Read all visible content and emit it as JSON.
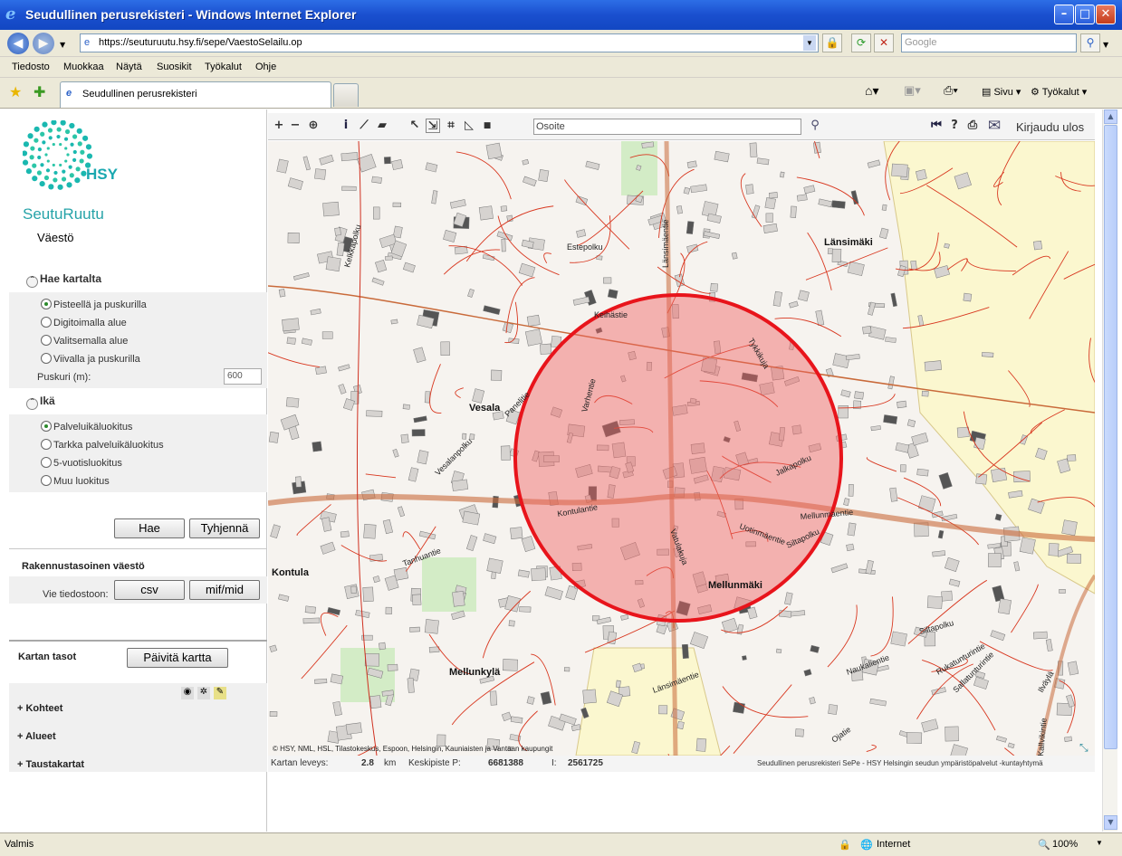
{
  "window": {
    "title": "Seudullinen perusrekisteri - Windows Internet Explorer",
    "url": "https://seuturuutu.hsy.fi/sepe/VaestoSelailu.op",
    "search_placeholder": "Google"
  },
  "menu": [
    "Tiedosto",
    "Muokkaa",
    "Näytä",
    "Suosikit",
    "Työkalut",
    "Ohje"
  ],
  "tab": {
    "label": "Seudullinen perusrekisteri"
  },
  "toolbar_right": {
    "sivu": "Sivu",
    "tyokalut": "Työkalut"
  },
  "left": {
    "logo_text": "HSY",
    "app_title": "SeutuRuutu",
    "app_subtitle": "Väestö",
    "hae_kartalta": {
      "title": "Hae kartalta",
      "options": [
        "Pisteellä ja puskurilla",
        "Digitoimalla alue",
        "Valitsemalla alue",
        "Viivalla ja puskurilla"
      ],
      "selected": "Pisteellä ja puskurilla",
      "buffer_label": "Puskuri (m):",
      "buffer_value": "600"
    },
    "ika": {
      "title": "Ikä",
      "options": [
        "Palveluikäluokitus",
        "Tarkka palveluikäluokitus",
        "5-vuotisluokitus",
        "Muu luokitus"
      ],
      "selected": "Palveluikäluokitus"
    },
    "buttons": {
      "hae": "Hae",
      "tyhjenna": "Tyhjennä"
    },
    "rakennus": {
      "title": "Rakennustasoinen väestö",
      "export_label": "Vie tiedostoon:",
      "csv": "csv",
      "mif": "mif/mid"
    },
    "layers": {
      "title": "Kartan tasot",
      "refresh": "Päivitä kartta",
      "groups": [
        "Kohteet",
        "Alueet",
        "Taustakartat"
      ]
    }
  },
  "map": {
    "address_placeholder": "Osoite",
    "logout": "Kirjaudu ulos",
    "places": [
      "Länsimäki",
      "Vesala",
      "Kontula",
      "Mellunmäki",
      "Mellunkylä"
    ],
    "streets": [
      "Estepolku",
      "Länsimäentie",
      "Keihästie",
      "Tykkikuja",
      "Varhentie",
      "Panelitie",
      "Kontulantie",
      "Jalkapolku",
      "Mellunmäentie",
      "Uotinmäentie",
      "Siltapolku",
      "Vatulakuja",
      "Länsimäentie",
      "Ojatie",
      "Ilväylä",
      "Kallvikintie",
      "Tanhuantie",
      "Kelkkapolku",
      "Sallatunturintie",
      "Siltapolku",
      "Rukatunturintie",
      "Naukalientie",
      "Vesalanpolku"
    ],
    "copyright": "© HSY, NML, HSL, Tilastokeskus, Espoon, Helsingin, Kauniaisten ja Vantaan kaupungit",
    "buffer_color": "#e8141b"
  },
  "map_status": {
    "width_label": "Kartan leveys:",
    "width_value": "2.8",
    "width_unit": "km",
    "center_label": "Keskipiste P:",
    "center_p": "6681388",
    "center_i_label": "I:",
    "center_i": "2561725",
    "credit": "Seudullinen perusrekisteri SePe - HSY Helsingin seudun ympäristöpalvelut -kuntayhtymä"
  },
  "statusbar": {
    "status": "Valmis",
    "zone": "Internet",
    "zoom": "100%"
  }
}
